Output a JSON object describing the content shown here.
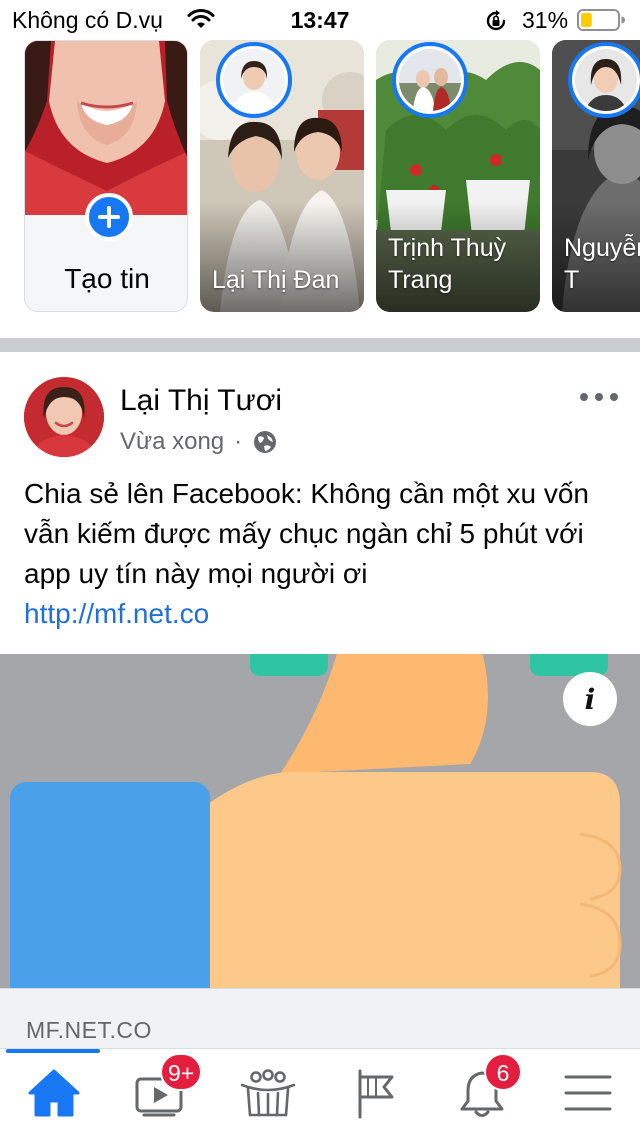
{
  "status_bar": {
    "carrier": "Không có D.vụ",
    "time": "13:47",
    "battery_percent": "31%",
    "battery_level": 0.31,
    "battery_color": "#ffcc00"
  },
  "stories": {
    "create": {
      "label": "Tạo tin"
    },
    "items": [
      {
        "name": "Lại Thị Đan"
      },
      {
        "name": "Trịnh Thuỳ Trang"
      },
      {
        "name": "Nguyễn Diệu T"
      }
    ]
  },
  "post": {
    "author": "Lại Thị Tươi",
    "time": "Vừa xong",
    "separator": "·",
    "text": "Chia sẻ lên Facebook: Không cần một xu vốn vẫn kiếm được mấy chục ngàn chỉ 5 phút với app uy tín này mọi người ơi",
    "link": "http://mf.net.co",
    "ad_info_glyph": "i",
    "link_domain": "MF.NET.CO"
  },
  "tab_bar": {
    "tabs": [
      {
        "name": "home-icon",
        "active": true
      },
      {
        "name": "watch-icon",
        "badge": "9+"
      },
      {
        "name": "groups-icon"
      },
      {
        "name": "pages-flag-icon"
      },
      {
        "name": "notifications-bell-icon",
        "badge": "6"
      },
      {
        "name": "menu-icon"
      }
    ]
  },
  "colors": {
    "accent": "#1877f2",
    "badge": "#e41e3f",
    "link": "#216fdb",
    "secondary_text": "#65676b"
  }
}
